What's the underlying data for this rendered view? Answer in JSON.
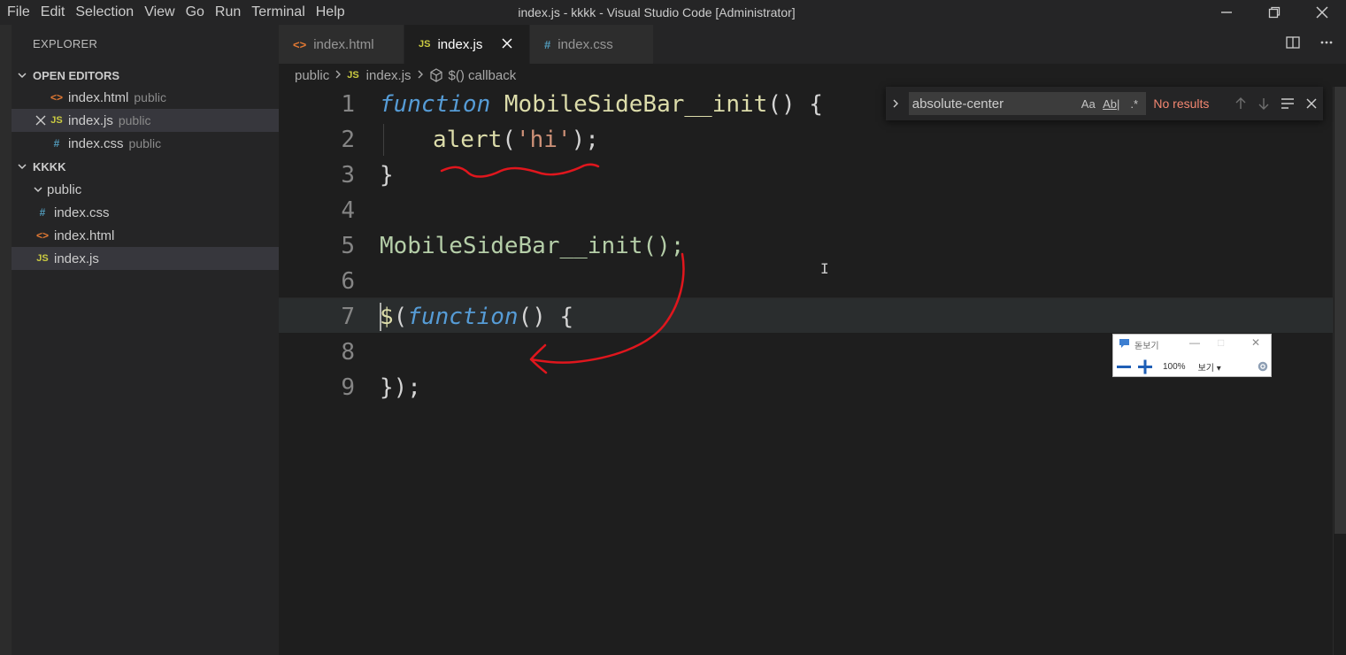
{
  "menu": [
    "File",
    "Edit",
    "Selection",
    "View",
    "Go",
    "Run",
    "Terminal",
    "Help"
  ],
  "window_title": "index.js - kkkk - Visual Studio Code [Administrator]",
  "sidebar": {
    "title": "EXPLORER",
    "open_editors": {
      "header": "OPEN EDITORS",
      "items": [
        {
          "name": "index.html",
          "desc": "public",
          "icon": "html-icon"
        },
        {
          "name": "index.js",
          "desc": "public",
          "icon": "js-icon"
        },
        {
          "name": "index.css",
          "desc": "public",
          "icon": "css-icon"
        }
      ]
    },
    "workspace": {
      "header": "KKKK",
      "folder": "public",
      "files": [
        "index.css",
        "index.html",
        "index.js"
      ]
    }
  },
  "tabs": [
    {
      "label": "index.html",
      "icon": "html-icon"
    },
    {
      "label": "index.js",
      "icon": "js-icon"
    },
    {
      "label": "index.css",
      "icon": "css-icon"
    }
  ],
  "breadcrumb": {
    "folder": "public",
    "file": "index.js",
    "symbol": "$() callback"
  },
  "editor": {
    "line_numbers": [
      "1",
      "2",
      "3",
      "4",
      "5",
      "6",
      "7",
      "8",
      "9"
    ],
    "lines": [
      "function MobileSideBar__init() {",
      "    alert('hi');",
      "}",
      "",
      "MobileSideBar__init();",
      "",
      "$(function() {",
      "",
      "});"
    ],
    "tokens": {
      "kw_function": "function",
      "fn_name": "MobileSideBar__init",
      "open_sig": "() {",
      "alert": "alert",
      "paren_open": "(",
      "str_hi": "'hi'",
      "paren_close_semi": ");",
      "close_brace": "}",
      "call_line": "MobileSideBar__init();",
      "dollar": "$",
      "paren": "(",
      "kw_function2": "function",
      "paren_brace": "() {",
      "close_all": "});"
    }
  },
  "find": {
    "value": "absolute-center",
    "options": [
      "Aa",
      "Ab|",
      ".*"
    ],
    "status": "No results"
  },
  "magnifier": {
    "title": "돋보기",
    "zoom": "100%",
    "view": "보기"
  },
  "colors": {
    "keyword": "#569cd6",
    "function": "#dcdcaa",
    "string": "#ce9178",
    "annotation": "#e0161d",
    "status_error": "#f48771"
  }
}
